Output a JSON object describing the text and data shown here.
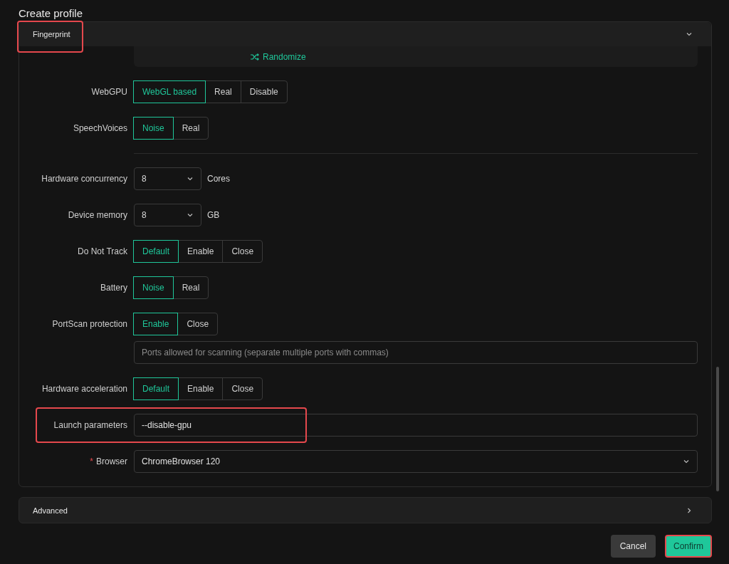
{
  "title": "Create profile",
  "fingerprint": {
    "label": "Fingerprint",
    "expanded": true,
    "highlighted": true,
    "randomize": "Randomize",
    "rows": [
      {
        "kind": "segmented",
        "label": "WebGPU",
        "options": [
          {
            "label": "WebGL based",
            "selected": true
          },
          {
            "label": "Real",
            "selected": false
          },
          {
            "label": "Disable",
            "selected": false
          }
        ]
      },
      {
        "kind": "segmented",
        "label": "SpeechVoices",
        "options": [
          {
            "label": "Noise",
            "selected": true
          },
          {
            "label": "Real",
            "selected": false
          }
        ]
      },
      {
        "kind": "divider"
      },
      {
        "kind": "select",
        "label": "Hardware concurrency",
        "value": "8",
        "unit": "Cores"
      },
      {
        "kind": "select",
        "label": "Device memory",
        "value": "8",
        "unit": "GB"
      },
      {
        "kind": "segmented",
        "label": "Do Not Track",
        "options": [
          {
            "label": "Default",
            "selected": true
          },
          {
            "label": "Enable",
            "selected": false
          },
          {
            "label": "Close",
            "selected": false
          }
        ]
      },
      {
        "kind": "segmented",
        "label": "Battery",
        "options": [
          {
            "label": "Noise",
            "selected": true
          },
          {
            "label": "Real",
            "selected": false
          }
        ]
      },
      {
        "kind": "segmented",
        "label": "PortScan protection",
        "options": [
          {
            "label": "Enable",
            "selected": true
          },
          {
            "label": "Close",
            "selected": false
          }
        ],
        "field": {
          "placeholder": "Ports allowed for scanning (separate multiple ports with commas)"
        }
      },
      {
        "kind": "segmented",
        "label": "Hardware acceleration",
        "options": [
          {
            "label": "Default",
            "selected": true
          },
          {
            "label": "Enable",
            "selected": false
          },
          {
            "label": "Close",
            "selected": false
          }
        ]
      },
      {
        "kind": "text",
        "label": "Launch parameters",
        "value": "--disable-gpu",
        "highlighted": true
      },
      {
        "kind": "dropdown",
        "label": "Browser",
        "required_mark": "*",
        "value": "ChromeBrowser 120"
      }
    ]
  },
  "advanced": {
    "label": "Advanced",
    "expanded": false
  },
  "buttons": [
    {
      "label": "Cancel",
      "kind": "secondary",
      "highlighted": false
    },
    {
      "label": "Confirm",
      "kind": "primary",
      "highlighted": true
    }
  ]
}
